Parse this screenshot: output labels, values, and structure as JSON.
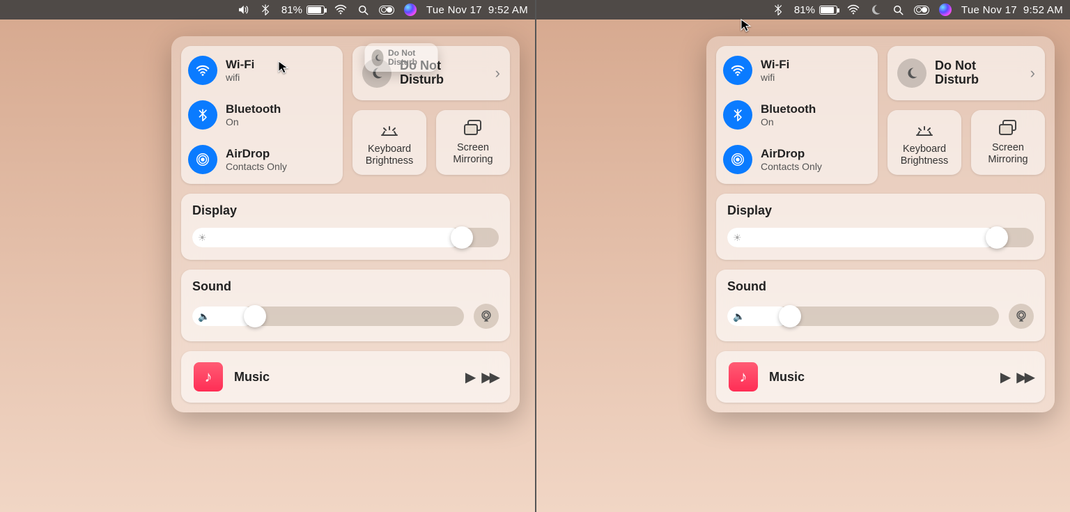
{
  "menubar": {
    "battery_percent": "81%",
    "date": "Tue Nov 17",
    "time": "9:52 AM"
  },
  "cc": {
    "wifi": {
      "title": "Wi-Fi",
      "sub": "wifi"
    },
    "bluetooth": {
      "title": "Bluetooth",
      "sub": "On"
    },
    "airdrop": {
      "title": "AirDrop",
      "sub": "Contacts Only"
    },
    "dnd": {
      "title": "Do Not Disturb"
    },
    "keyboard_brightness": "Keyboard Brightness",
    "screen_mirroring": "Screen Mirroring",
    "display": "Display",
    "display_value_pct": 88,
    "sound": "Sound",
    "sound_value_pct": 23,
    "music": "Music"
  },
  "drag_chip": {
    "label": "Do Not Disturb"
  },
  "colors": {
    "accent": "#0a7bff",
    "music": "#ff2d55"
  }
}
